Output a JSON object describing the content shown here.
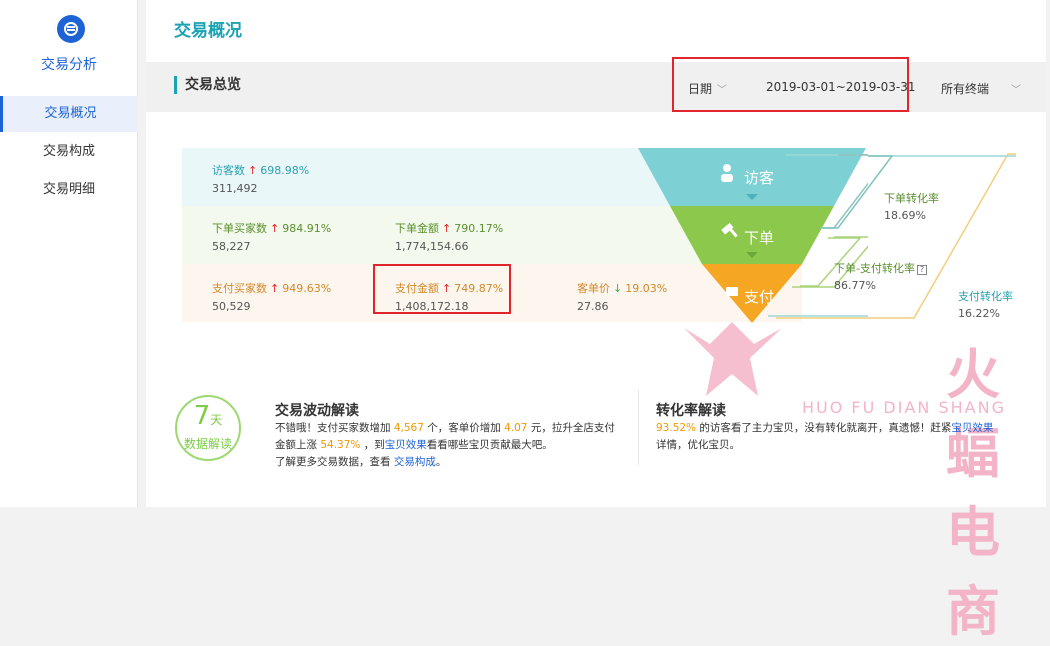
{
  "sidebar": {
    "title": "交易分析",
    "items": [
      {
        "label": "交易概况",
        "active": true
      },
      {
        "label": "交易构成",
        "active": false
      },
      {
        "label": "交易明细",
        "active": false
      }
    ]
  },
  "page": {
    "title": "交易概况"
  },
  "overview": {
    "title": "交易总览",
    "date_label": "日期",
    "date_range": "2019-03-01~2019-03-31",
    "terminal": "所有终端"
  },
  "metrics": {
    "visitors": {
      "label": "访客数",
      "pct": "698.98%",
      "value": "311,492"
    },
    "order_buyers": {
      "label": "下单买家数",
      "pct": "984.91%",
      "value": "58,227"
    },
    "order_amount": {
      "label": "下单金额",
      "pct": "790.17%",
      "value": "1,774,154.66"
    },
    "pay_buyers": {
      "label": "支付买家数",
      "pct": "949.63%",
      "value": "50,529"
    },
    "pay_amount": {
      "label": "支付金额",
      "pct": "749.87%",
      "value": "1,408,172.18"
    },
    "unit_price": {
      "label": "客单价",
      "pct": "19.03%",
      "value": "27.86"
    }
  },
  "funnel": {
    "stage1": "访客",
    "stage2": "下单",
    "stage3": "支付",
    "rate_order": {
      "label": "下单转化率",
      "value": "18.69%"
    },
    "rate_order_pay": {
      "label": "下单-支付转化率",
      "value": "86.77%"
    },
    "rate_pay": {
      "label": "支付转化率",
      "value": "16.22%"
    }
  },
  "badge": {
    "num": "7",
    "unit": "天",
    "text": "数据解读"
  },
  "fluctuation": {
    "title": "交易波动解读",
    "p1a": "不错哦！支付买家数增加",
    "p1b": "4,567",
    "p1c": "个，客单价增加",
    "p1d": "4.07",
    "p1e": "元，拉升全店支付",
    "p2a": "金额上涨",
    "p2b": "54.37%",
    "p2c": "，到",
    "p2d": "宝贝效果",
    "p2e": "看看哪些宝贝贡献最大吧。",
    "p3a": "了解更多交易数据，查看",
    "p3b": "交易构成",
    "p3c": "。"
  },
  "conversion": {
    "title": "转化率解读",
    "p1a": "93.52%",
    "p1b": "的访客看了主力宝贝，没有转化就离开，真遗憾！赶紧",
    "p1c": "宝贝效果",
    "p2": "详情，优化宝贝。"
  },
  "watermark": {
    "cn": "火蝠电商",
    "en": "HUO FU DIAN SHANG"
  },
  "colors": {
    "accent": "#1aa3b5",
    "brand": "#1e63d6",
    "highlight": "#e0252d",
    "stage1": "#7dd0d4",
    "stage2": "#8cc84b",
    "stage3": "#f5a623"
  }
}
